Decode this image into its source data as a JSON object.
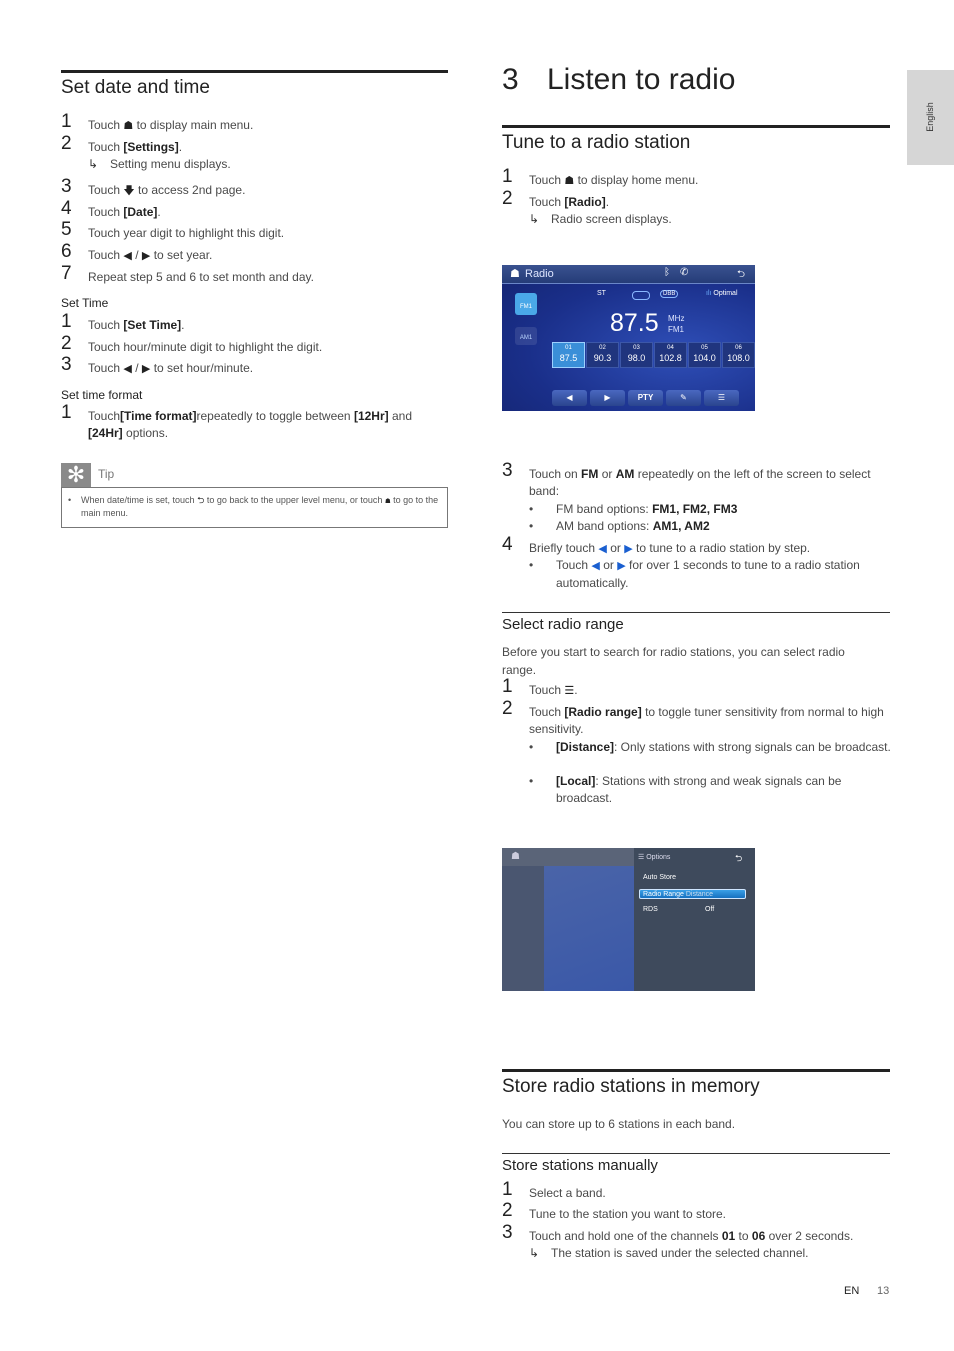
{
  "side_tab": {
    "label": "English"
  },
  "left": {
    "title": "Set date and time",
    "steps": [
      {
        "n": "1",
        "a": "Touch",
        "b": "to display main menu."
      },
      {
        "n": "2",
        "a": "Touch",
        "b": "[Settings]",
        "c": ".",
        "result": "Setting menu displays."
      },
      {
        "n": "3",
        "a": "Touch",
        "b": "to access 2nd page."
      },
      {
        "n": "4",
        "a": "Touch",
        "b": "[Date]",
        "c": "."
      },
      {
        "n": "5",
        "a": "Touch year digit to highlight this digit."
      },
      {
        "n": "6",
        "a": "Touch",
        "b": "/",
        "c": "to set year."
      },
      {
        "n": "7",
        "a": "Repeat step 5 and 6 to set month and day."
      }
    ],
    "set_time": {
      "title": "Set Time",
      "steps": [
        {
          "n": "1",
          "a": "Touch",
          "b": "[Set Time]",
          "c": "."
        },
        {
          "n": "2",
          "a": "Touch hour/minute digit to highlight the digit."
        },
        {
          "n": "3",
          "a": "Touch",
          "b": "/",
          "c": "to set hour/minute."
        }
      ]
    },
    "set_format": {
      "title": "Set time format",
      "steps": [
        {
          "n": "1",
          "a": "Touch",
          "b": "[Time format]",
          "c": "repeatedly to toggle between",
          "d": "[12Hr]",
          "e": "and",
          "f": "[24Hr]",
          "g": "options."
        }
      ]
    },
    "tip": {
      "label": "Tip",
      "a": "When date/time is set, touch",
      "b": "to go back to the upper level menu, or touch",
      "c": "to go to the main menu."
    }
  },
  "right": {
    "chapter_number": "3",
    "chapter_title": "Listen to radio",
    "tune": {
      "title": "Tune to a radio station",
      "steps": [
        {
          "n": "1",
          "a": "Touch",
          "b": "to display home menu."
        },
        {
          "n": "2",
          "a": "Touch",
          "b": "[Radio]",
          "c": ".",
          "result": "Radio screen displays."
        },
        {
          "n": "3",
          "a": "Touch on",
          "b": "FM",
          "c": "or",
          "d": "AM",
          "e": "repeatedly on the left of the screen to select band:",
          "bullets": [
            {
              "a": "FM band options:",
              "b": "FM1, FM2, FM3"
            },
            {
              "a": "AM band options:",
              "b": "AM1, AM2"
            }
          ]
        },
        {
          "n": "4",
          "a": "Briefly touch",
          "b": "or",
          "c": "to tune to a radio station by step.",
          "bullet": {
            "a": "Touch",
            "b": "or",
            "c": "for over 1 seconds to tune to a radio station automatically."
          }
        }
      ]
    },
    "radio_screen": {
      "title": "Radio",
      "st": "ST",
      "dbb": "DBB",
      "signal": "Optimal",
      "frequency": "87.5",
      "unit": "MHz",
      "band": "FM1",
      "bands": [
        "FM1",
        "AM1"
      ],
      "presets": [
        {
          "n": "01",
          "f": "87.5"
        },
        {
          "n": "02",
          "f": "90.3"
        },
        {
          "n": "03",
          "f": "98.0"
        },
        {
          "n": "04",
          "f": "102.8"
        },
        {
          "n": "05",
          "f": "104.0"
        },
        {
          "n": "06",
          "f": "108.0"
        }
      ],
      "pty": "PTY",
      "accent": "#3a8fd8"
    },
    "range": {
      "title": "Select radio range",
      "intro": "Before you start to search for radio stations, you can select radio range.",
      "steps": [
        {
          "n": "1",
          "a": "Touch",
          "b": "."
        },
        {
          "n": "2",
          "a": "Touch",
          "b": "[Radio range]",
          "c": "to toggle tuner sensitivity from normal to high sensitivity."
        }
      ],
      "bullets": [
        {
          "a": "[Distance]",
          "b": ": Only stations with strong signals can be broadcast."
        },
        {
          "a": "[Local]",
          "b": ": Stations with strong and weak signals can be broadcast."
        }
      ]
    },
    "options_screen": {
      "title": "Options",
      "rows": [
        {
          "k": "Auto Store",
          "v": ""
        },
        {
          "k": "Radio Range",
          "v": "Distance"
        },
        {
          "k": "RDS",
          "v": "Off"
        }
      ]
    },
    "store": {
      "title": "Store radio stations in memory",
      "intro": "You can store up to 6 stations in each band.",
      "manual_title": "Store stations manually",
      "steps": [
        {
          "n": "1",
          "a": "Select a band."
        },
        {
          "n": "2",
          "a": "Tune to the station you want to store."
        },
        {
          "n": "3",
          "a": "Touch and hold one of the channels",
          "b": "01",
          "c": "to",
          "d": "06",
          "e": "over 2 seconds.",
          "result": "The station is saved under the selected channel."
        }
      ]
    }
  },
  "footer": {
    "lang": "EN",
    "page": "13"
  }
}
